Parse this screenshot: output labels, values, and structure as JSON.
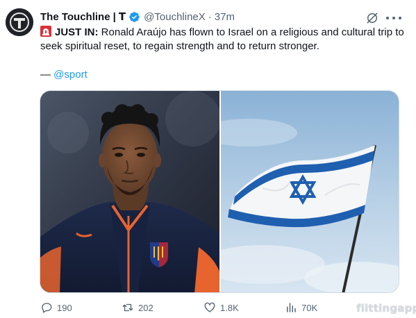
{
  "tweet": {
    "author_name": "The Touchline",
    "name_suffix": "| 𝗧",
    "handle": "@TouchlineX",
    "separator": "·",
    "time": "37m",
    "lead": "JUST IN:",
    "text": " Ronald Araújo has flown to Israel on a religious and cultural trip to seek spiritual reset, to regain strength and to return stronger.",
    "source_dash": "—",
    "source_mention": "@sport",
    "accent_color": "#1d9bf0"
  },
  "actions": {
    "replies": "190",
    "reposts": "202",
    "likes": "1.8K",
    "views": "70K"
  },
  "watermark": "flittingapp"
}
